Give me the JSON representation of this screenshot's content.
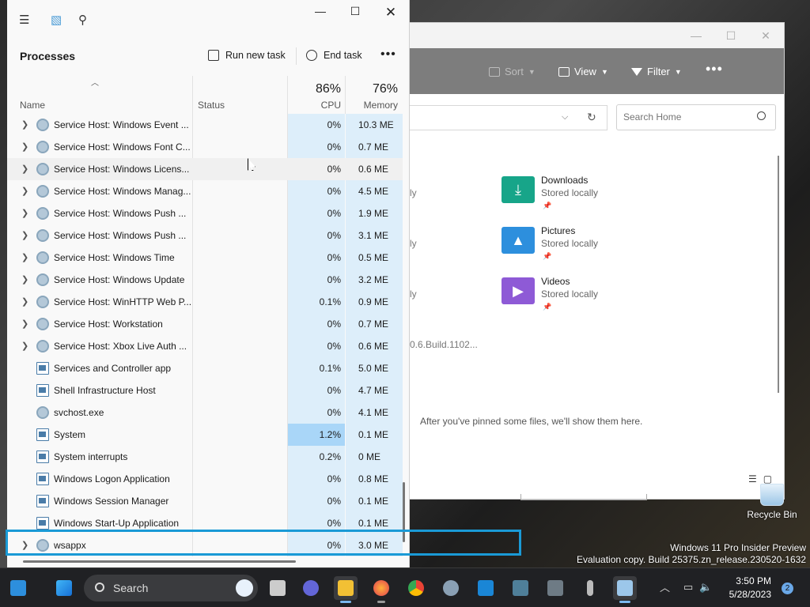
{
  "taskmgr": {
    "heading": "Processes",
    "run_new_task": "Run new task",
    "end_task": "End task",
    "columns": {
      "name": "Name",
      "status": "Status",
      "cpu_pct": "86%",
      "cpu": "CPU",
      "mem_pct": "76%",
      "mem": "Memory"
    },
    "rows": [
      {
        "name": "Service Host: Windows Event ...",
        "cpu": "0%",
        "mem": "10.3 ME",
        "expandable": true,
        "icon": "gear"
      },
      {
        "name": "Service Host: Windows Font C...",
        "cpu": "0%",
        "mem": "0.7 ME",
        "expandable": true,
        "icon": "gear"
      },
      {
        "name": "Service Host: Windows Licens...",
        "cpu": "0%",
        "mem": "0.6 ME",
        "expandable": true,
        "icon": "gear"
      },
      {
        "name": "Service Host: Windows Manag...",
        "cpu": "0%",
        "mem": "4.5 ME",
        "expandable": true,
        "icon": "gear"
      },
      {
        "name": "Service Host: Windows Push ...",
        "cpu": "0%",
        "mem": "1.9 ME",
        "expandable": true,
        "icon": "gear"
      },
      {
        "name": "Service Host: Windows Push ...",
        "cpu": "0%",
        "mem": "3.1 ME",
        "expandable": true,
        "icon": "gear"
      },
      {
        "name": "Service Host: Windows Time",
        "cpu": "0%",
        "mem": "0.5 ME",
        "expandable": true,
        "icon": "gear"
      },
      {
        "name": "Service Host: Windows Update",
        "cpu": "0%",
        "mem": "3.2 ME",
        "expandable": true,
        "icon": "gear"
      },
      {
        "name": "Service Host: WinHTTP Web P...",
        "cpu": "0.1%",
        "mem": "0.9 ME",
        "expandable": true,
        "icon": "gear"
      },
      {
        "name": "Service Host: Workstation",
        "cpu": "0%",
        "mem": "0.7 ME",
        "expandable": true,
        "icon": "gear"
      },
      {
        "name": "Service Host: Xbox Live Auth ...",
        "cpu": "0%",
        "mem": "0.6 ME",
        "expandable": true,
        "icon": "gear"
      },
      {
        "name": "Services and Controller app",
        "cpu": "0.1%",
        "mem": "5.0 ME",
        "expandable": false,
        "icon": "app"
      },
      {
        "name": "Shell Infrastructure Host",
        "cpu": "0%",
        "mem": "4.7 ME",
        "expandable": false,
        "icon": "app"
      },
      {
        "name": "svchost.exe",
        "cpu": "0%",
        "mem": "4.1 ME",
        "expandable": false,
        "icon": "gear"
      },
      {
        "name": "System",
        "cpu": "1.2%",
        "mem": "0.1 ME",
        "expandable": false,
        "icon": "app"
      },
      {
        "name": "System interrupts",
        "cpu": "0.2%",
        "mem": "0 ME",
        "expandable": false,
        "icon": "app"
      },
      {
        "name": "Windows Logon Application",
        "cpu": "0%",
        "mem": "0.8 ME",
        "expandable": false,
        "icon": "app"
      },
      {
        "name": "Windows Session Manager",
        "cpu": "0%",
        "mem": "0.1 ME",
        "expandable": false,
        "icon": "app"
      },
      {
        "name": "Windows Start-Up Application",
        "cpu": "0%",
        "mem": "0.1 ME",
        "expandable": false,
        "icon": "app"
      },
      {
        "name": "wsappx",
        "cpu": "0%",
        "mem": "3.0 ME",
        "expandable": true,
        "icon": "gear"
      }
    ]
  },
  "explorer": {
    "sort": "Sort",
    "view": "View",
    "filter": "Filter",
    "search_placeholder": "Search Home",
    "quick_access": [
      {
        "name": "Downloads",
        "state": "Stored locally"
      },
      {
        "name": "Pictures",
        "state": "Stored locally"
      },
      {
        "name": "Videos",
        "state": "Stored locally"
      }
    ],
    "cutoff_texts": [
      "ly",
      "ly",
      "ly"
    ],
    "build_text": "0.6.Build.1102...",
    "pinned_empty": "After you've pinned some files, we'll show them here."
  },
  "desktop": {
    "recycle_bin": "Recycle Bin",
    "watermark_line1": "Windows 11 Pro Insider Preview",
    "watermark_line2": "Evaluation copy. Build 25375.zn_release.230520-1632"
  },
  "taskbar": {
    "search_label": "Search",
    "time": "3:50 PM",
    "date": "5/28/2023",
    "notifications": "2"
  }
}
